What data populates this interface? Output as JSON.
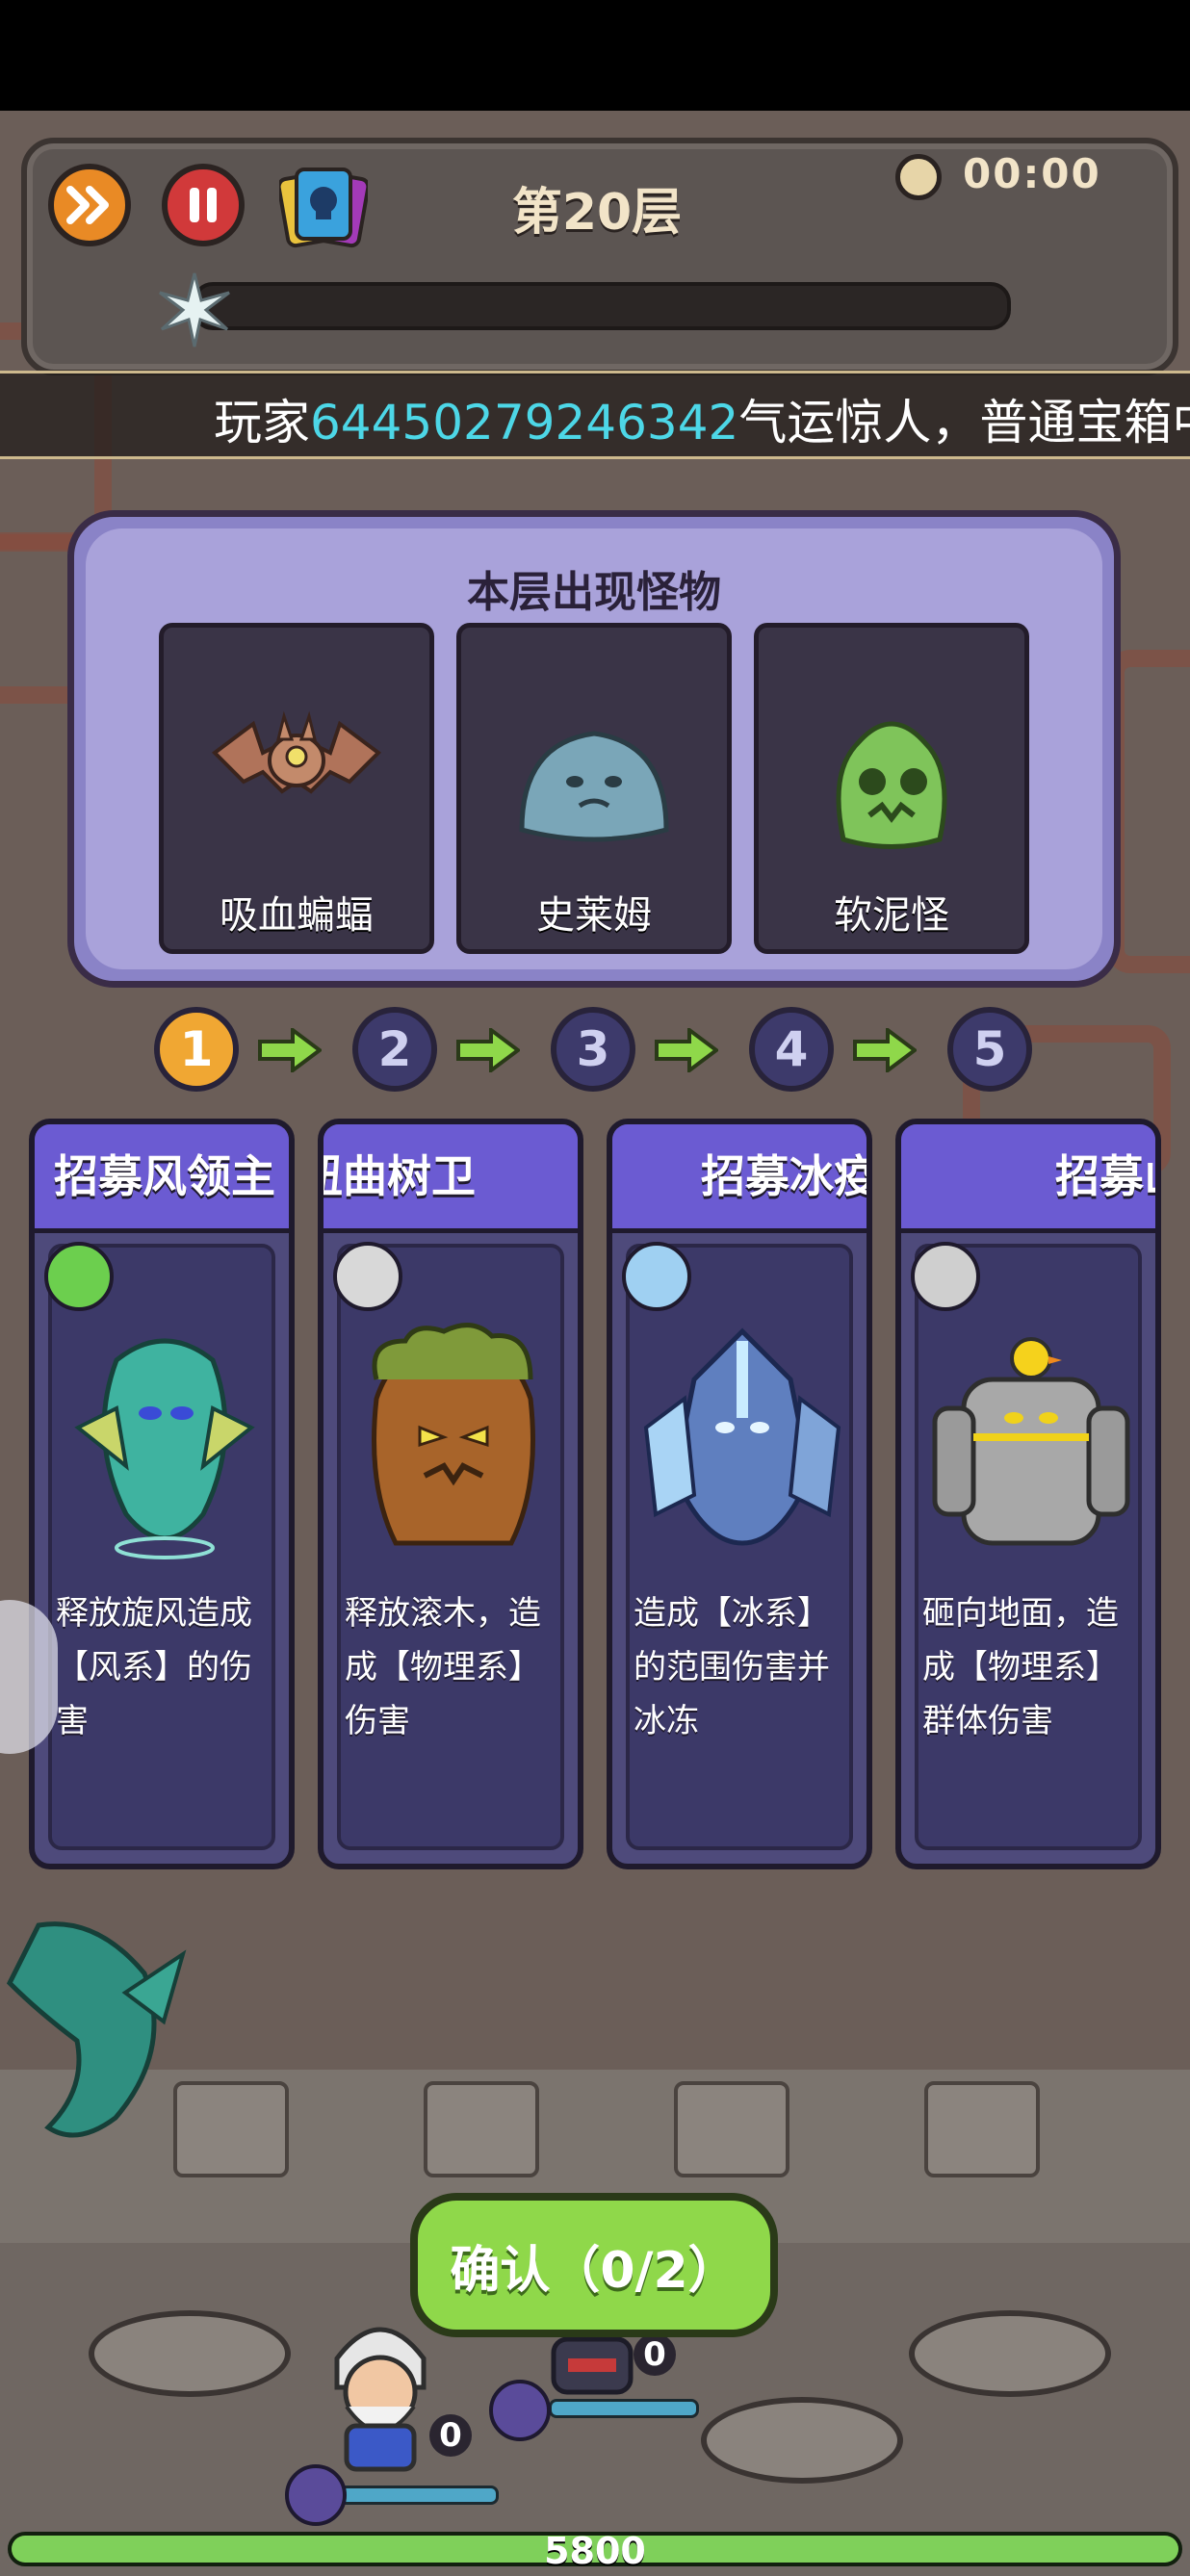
{
  "hud": {
    "floor_title": "第20层",
    "timer": "00:00",
    "floor_progress": 0
  },
  "announcement": {
    "prefix": "玩家",
    "player_id": "64450279246342",
    "suffix": "气运惊人，普通宝箱中"
  },
  "monster_panel": {
    "title": "本层出现怪物",
    "monsters": [
      {
        "name": "吸血蝙蝠",
        "icon": "bat-icon"
      },
      {
        "name": "史莱姆",
        "icon": "slime-icon"
      },
      {
        "name": "软泥怪",
        "icon": "ooze-icon"
      }
    ]
  },
  "stages": [
    "1",
    "2",
    "3",
    "4",
    "5"
  ],
  "active_stage": 1,
  "hero_cards": [
    {
      "title": "招募风领主",
      "element": "wind-element-icon",
      "description": "释放旋风造成【风系】的伤害",
      "accent": "#2fb3a6"
    },
    {
      "title": "扭曲树卫",
      "element": "physical-element-icon",
      "description": "释放滚木，造成【物理系】伤害",
      "accent": "#a66a2a"
    },
    {
      "title": "招募冰疫",
      "element": "ice-element-icon",
      "description": "造成【冰系】的范围伤害并冰冻",
      "accent": "#6fa0e6"
    },
    {
      "title": "招募山",
      "element": "rock-element-icon",
      "description": "砸向地面，造成【物理系】群体伤害",
      "accent": "#b5b5b5"
    }
  ],
  "confirm_button": "确认（0/2）",
  "units": [
    {
      "count": "0"
    },
    {
      "count": "0"
    }
  ],
  "base_hp": "5800",
  "colors": {
    "panel_purple": "#8a83c7",
    "card_header": "#6b5bd2",
    "confirm_green": "#8fd84a",
    "highlight_id": "#4dd7e7",
    "active_stage": "#f0a733"
  }
}
